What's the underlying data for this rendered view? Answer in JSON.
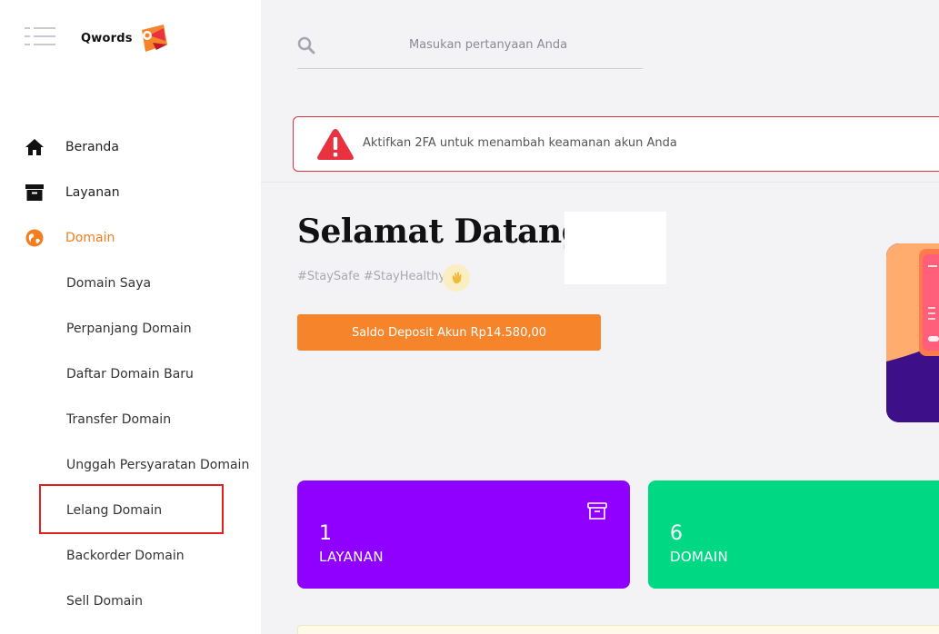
{
  "brand": {
    "name": "Qwords"
  },
  "sidebar": {
    "nav": [
      {
        "label": "Beranda",
        "icon": "home-icon"
      },
      {
        "label": "Layanan",
        "icon": "archive-box-icon"
      },
      {
        "label": "Domain",
        "icon": "globe-icon",
        "active": true
      }
    ],
    "domain_submenu": [
      {
        "label": "Domain Saya"
      },
      {
        "label": "Perpanjang Domain"
      },
      {
        "label": "Daftar Domain Baru"
      },
      {
        "label": "Transfer Domain"
      },
      {
        "label": "Unggah Persyaratan Domain"
      },
      {
        "label": "Lelang Domain",
        "highlighted": true
      },
      {
        "label": "Backorder Domain"
      },
      {
        "label": "Sell Domain"
      }
    ]
  },
  "search": {
    "placeholder": "Masukan pertanyaan Anda"
  },
  "alert": {
    "text": "Aktifkan 2FA untuk menambah keamanan akun Anda",
    "icon": "warning-triangle-icon",
    "color": "#e8323f"
  },
  "welcome": {
    "heading": "Selamat Datang,",
    "hashtags": "#StaySafe #StayHealthy",
    "wave_icon": "waving-hand-icon"
  },
  "deposit": {
    "label": "Saldo Deposit Akun Rp14.580,00",
    "color": "#f6842a"
  },
  "stats": [
    {
      "value": "1",
      "label": "LAYANAN",
      "color": "#8f00ff",
      "icon": "archive-box-icon"
    },
    {
      "value": "6",
      "label": "DOMAIN",
      "color": "#00d884",
      "icon": "globe-icon"
    }
  ],
  "colors": {
    "accent": "#f47d20",
    "alert_border": "#d6333f",
    "highlight": "#e02020"
  }
}
